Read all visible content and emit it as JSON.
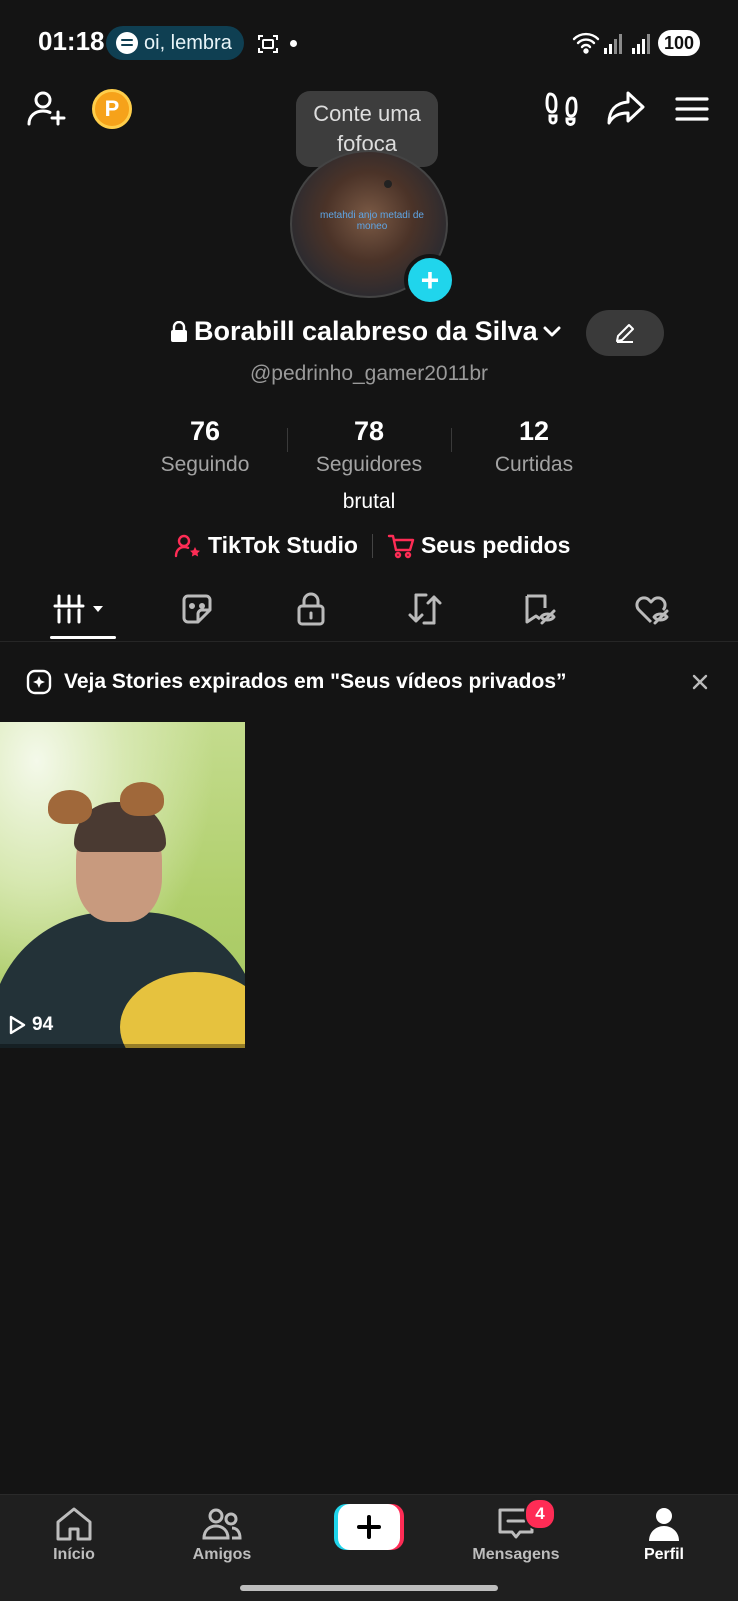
{
  "status_bar": {
    "time": "01:18",
    "spotify_text": "oi, lembra",
    "battery": "100",
    "icons": [
      "spotify-icon",
      "screenshot-icon",
      "wifi-icon",
      "signal-icon",
      "signal-icon-2"
    ]
  },
  "top_bar": {
    "coin_letter": "P",
    "tooltip": "Conte uma fofoca",
    "icons": [
      "add-friend-icon",
      "footprint-icon",
      "share-icon",
      "menu-icon"
    ]
  },
  "profile": {
    "avatar_caption": "metahdi anjo metadi de moneo",
    "name": "Borabill calabreso da Silva",
    "handle": "@pedrinho_gamer2011br",
    "bio": "brutal"
  },
  "stats": [
    {
      "value": "76",
      "label": "Seguindo"
    },
    {
      "value": "78",
      "label": "Seguidores"
    },
    {
      "value": "12",
      "label": "Curtidas"
    }
  ],
  "links": {
    "studio": "TikTok Studio",
    "orders": "Seus pedidos"
  },
  "tabs": [
    "videos-tab",
    "reposts-sticker-tab",
    "private-tab",
    "repost-tab",
    "favorites-tab",
    "liked-tab"
  ],
  "banner": {
    "text": "Veja Stories expirados em \"Seus vídeos privados”"
  },
  "videos": [
    {
      "views": "94"
    }
  ],
  "bottom_nav": {
    "items": [
      {
        "label": "Início"
      },
      {
        "label": "Amigos"
      },
      {
        "label": "Mensagens"
      },
      {
        "label": "Perfil"
      }
    ],
    "messages_badge": "4"
  },
  "colors": {
    "background": "#141414",
    "accent_red": "#fe2c55",
    "accent_cyan": "#20d5ec",
    "coin": "#f6a21a"
  }
}
